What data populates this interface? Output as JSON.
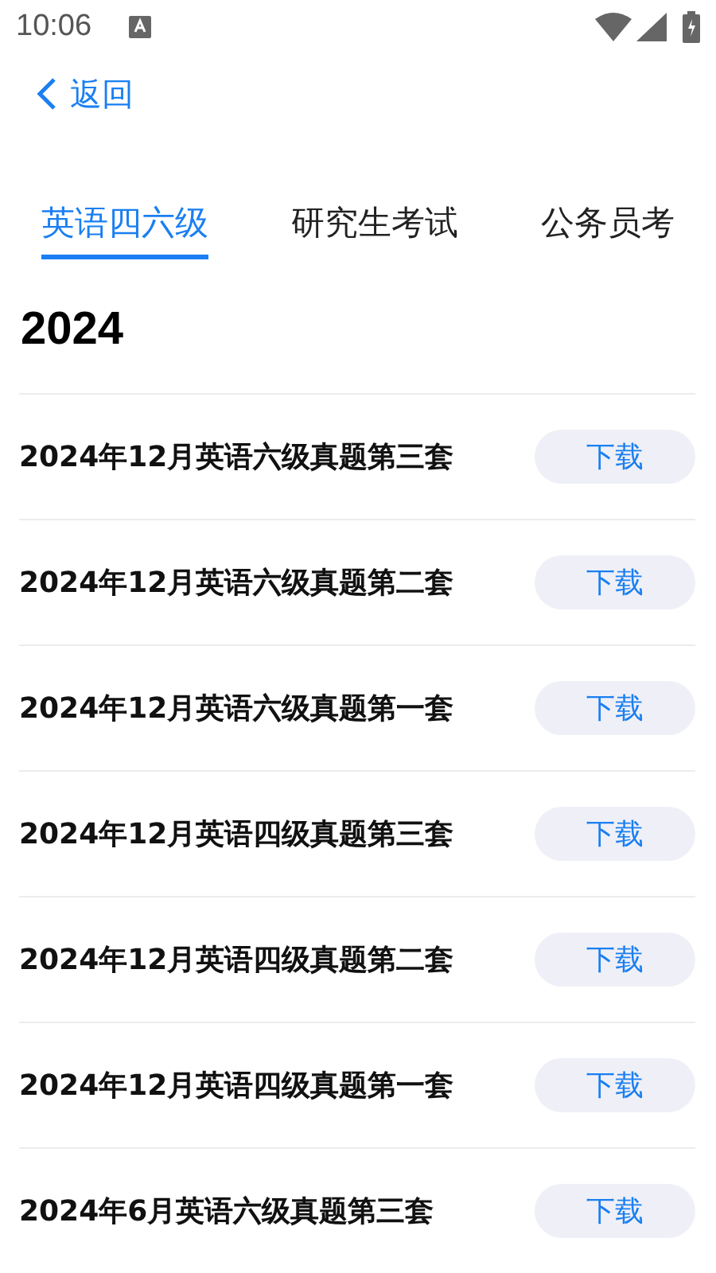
{
  "status_bar": {
    "time": "10:06"
  },
  "back": {
    "label": "返回"
  },
  "tabs": [
    {
      "label": "英语四六级",
      "selected": true
    },
    {
      "label": "研究生考试",
      "selected": false
    },
    {
      "label": "公务员考",
      "selected": false
    }
  ],
  "year": "2024",
  "items": [
    {
      "title": "2024年12月英语六级真题第三套",
      "action": "下载"
    },
    {
      "title": "2024年12月英语六级真题第二套",
      "action": "下载"
    },
    {
      "title": "2024年12月英语六级真题第一套",
      "action": "下载"
    },
    {
      "title": "2024年12月英语四级真题第三套",
      "action": "下载"
    },
    {
      "title": "2024年12月英语四级真题第二套",
      "action": "下载"
    },
    {
      "title": "2024年12月英语四级真题第一套",
      "action": "下载"
    },
    {
      "title": "2024年6月英语六级真题第三套",
      "action": "下载"
    }
  ]
}
